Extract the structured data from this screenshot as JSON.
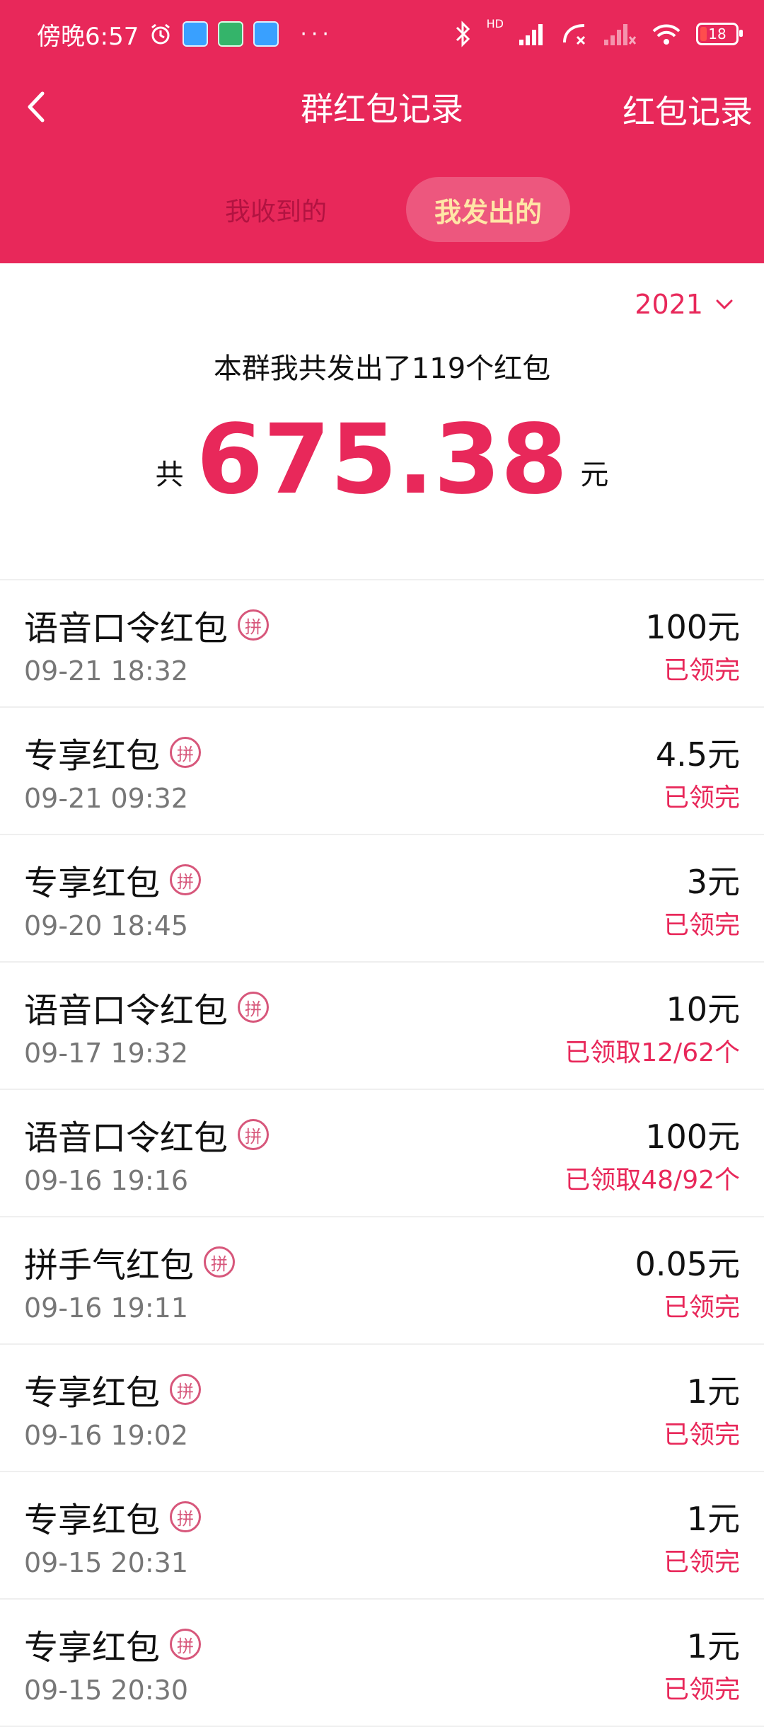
{
  "status_bar": {
    "time": "傍晚6:57",
    "battery": "18",
    "dots": "···",
    "signal_label": "HD"
  },
  "header": {
    "title": "群红包记录",
    "right_link": "红包记录",
    "accent_color": "#e8285a"
  },
  "tabs": {
    "received": "我收到的",
    "sent": "我发出的",
    "active": "sent"
  },
  "summary": {
    "year": "2021",
    "text": "本群我共发出了119个红包",
    "prefix": "共",
    "amount": "675.38",
    "unit": "元"
  },
  "records": [
    {
      "title": "语音口令红包",
      "tag": "拼",
      "time": "09-21 18:32",
      "amount": "100元",
      "status": "已领完"
    },
    {
      "title": "专享红包",
      "tag": "拼",
      "time": "09-21 09:32",
      "amount": "4.5元",
      "status": "已领完"
    },
    {
      "title": "专享红包",
      "tag": "拼",
      "time": "09-20 18:45",
      "amount": "3元",
      "status": "已领完"
    },
    {
      "title": "语音口令红包",
      "tag": "拼",
      "time": "09-17 19:32",
      "amount": "10元",
      "status": "已领取12/62个"
    },
    {
      "title": "语音口令红包",
      "tag": "拼",
      "time": "09-16 19:16",
      "amount": "100元",
      "status": "已领取48/92个"
    },
    {
      "title": "拼手气红包",
      "tag": "拼",
      "time": "09-16 19:11",
      "amount": "0.05元",
      "status": "已领完"
    },
    {
      "title": "专享红包",
      "tag": "拼",
      "time": "09-16 19:02",
      "amount": "1元",
      "status": "已领完"
    },
    {
      "title": "专享红包",
      "tag": "拼",
      "time": "09-15 20:31",
      "amount": "1元",
      "status": "已领完"
    },
    {
      "title": "专享红包",
      "tag": "拼",
      "time": "09-15 20:30",
      "amount": "1元",
      "status": "已领完"
    }
  ]
}
